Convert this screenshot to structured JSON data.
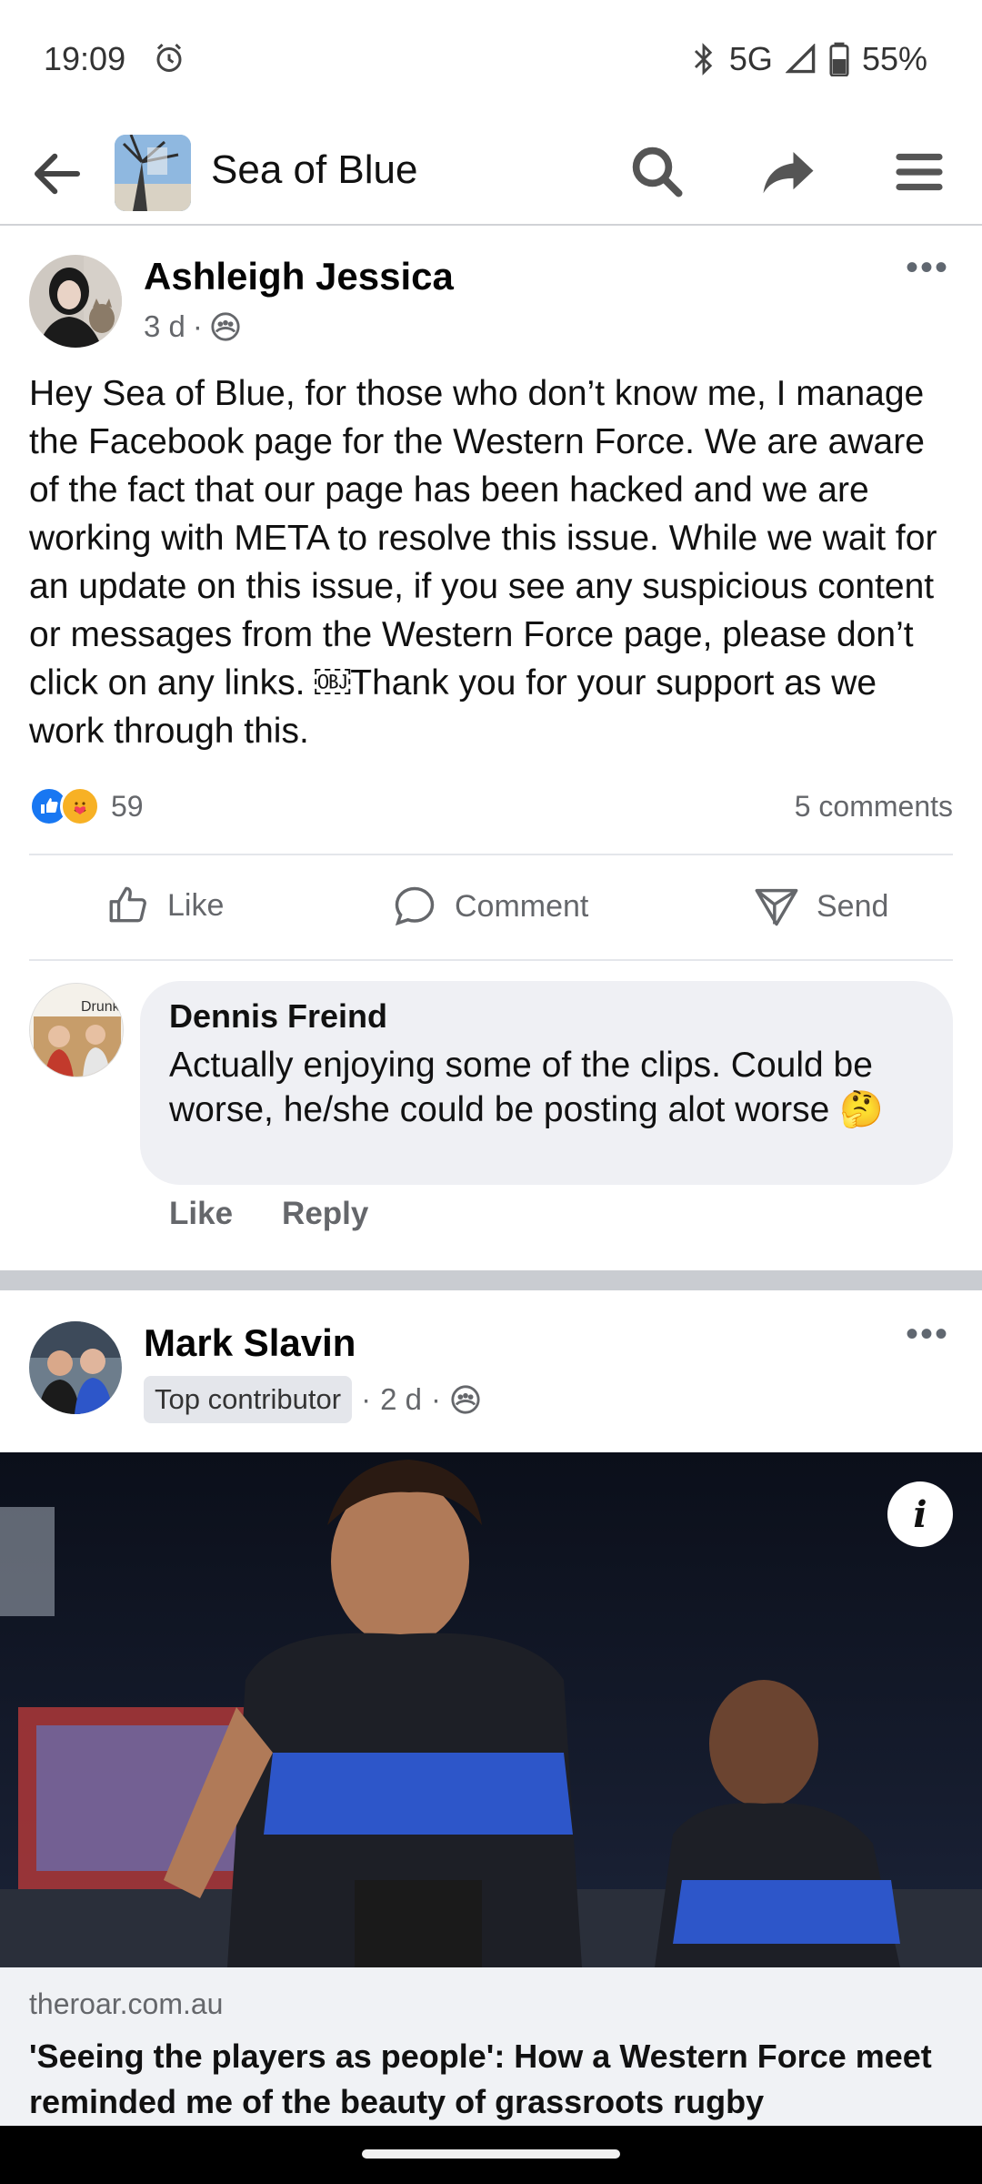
{
  "status_bar": {
    "time": "19:09",
    "network": "5G",
    "battery": "55%"
  },
  "header": {
    "group_name": "Sea of Blue"
  },
  "post1": {
    "author": "Ashleigh Jessica",
    "time": "3 d",
    "audience_icon": "group-icon",
    "body": "Hey Sea of Blue, for those who don’t know me, I manage the Facebook page for the Western Force. We are aware of the fact that our page has been hacked and we are working with META to resolve this issue. While we wait for an update on this issue, if you see any suspicious content or messages from the Western Force page, please don’t click on any links. ￼Thank you for your support as we work through this.",
    "reaction_count": "59",
    "comments_count": "5 comments",
    "actions": {
      "like": "Like",
      "comment": "Comment",
      "send": "Send"
    }
  },
  "comment": {
    "author": "Dennis Freind",
    "text": "Actually enjoying some of the clips. Could be worse, he/she could be posting alot worse 🤔",
    "like": "Like",
    "reply": "Reply",
    "avatar_text": "Drunk"
  },
  "post2": {
    "author": "Mark Slavin",
    "badge": "Top contributor",
    "time": "2 d",
    "link_domain": "theroar.com.au",
    "link_title": "'Seeing the players as people': How a Western Force meet reminded me of the beauty of grassroots rugby"
  },
  "colors": {
    "accent": "#1877f2",
    "muted_text": "#65676b",
    "bubble": "#eff0f4",
    "jersey_blue": "#2d56c9"
  }
}
